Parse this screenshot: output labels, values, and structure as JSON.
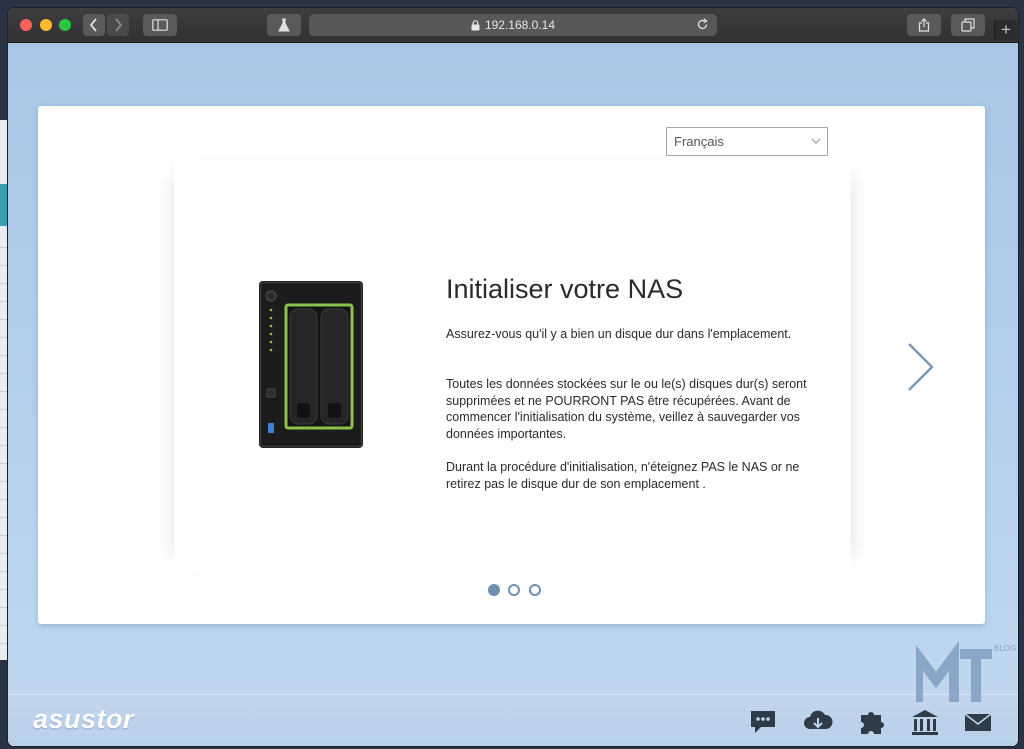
{
  "browser": {
    "url": "192.168.0.14",
    "new_tab_label": "+"
  },
  "setup": {
    "language": "Français",
    "title": "Initialiser votre NAS",
    "paragraphs": [
      "Assurez-vous qu'il y a bien un disque dur dans l'emplacement.",
      "Toutes les données stockées sur le ou le(s) disques dur(s) seront supprimées et ne POURRONT PAS être récupérées. Avant de commencer l'initialisation du système, veillez à sauvegarder vos données importantes.",
      "Durant la procédure d'initialisation, n'éteignez PAS le NAS or ne retirez pas le disque dur de son emplacement ."
    ],
    "pagination": {
      "current": 1,
      "total": 3
    }
  },
  "taskbar": {
    "logo_text": "asustor",
    "icons": [
      "chat-icon",
      "cloud-download-icon",
      "puzzle-icon",
      "bank-icon",
      "mail-icon"
    ]
  },
  "watermark": {
    "text": "BLOG"
  },
  "colors": {
    "accent": "#6f8fae",
    "nas_highlight": "#8bc34a",
    "page_bg": "#a9c6e6"
  }
}
